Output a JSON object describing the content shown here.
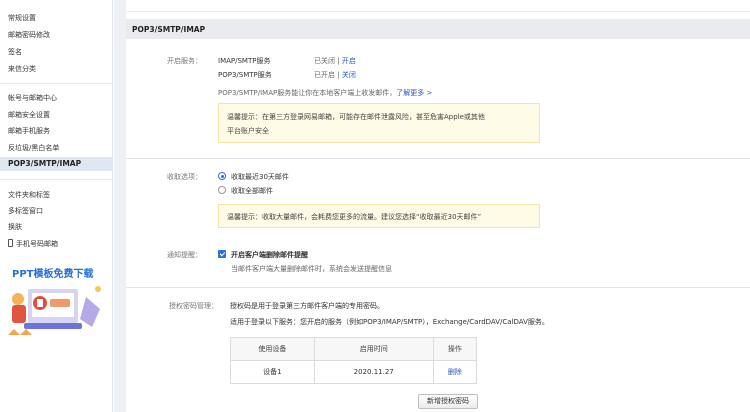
{
  "sidebar": {
    "group1": [
      "常规设置",
      "邮箱密码修改",
      "签名",
      "来信分类"
    ],
    "group2": [
      "帐号与邮箱中心",
      "邮箱安全设置",
      "邮箱手机服务",
      "反垃圾/黑白名单",
      "POP3/SMTP/IMAP"
    ],
    "group3": [
      "文件夹和标签",
      "多标签窗口",
      "换肤",
      "手机号码邮箱"
    ],
    "ad_title": "PPT模板免费下载"
  },
  "section": {
    "title": "POP3/SMTP/IMAP"
  },
  "services": {
    "label": "开启服务：",
    "rows": [
      {
        "name": "IMAP/SMTP服务",
        "status": "已关闭",
        "sep": "|",
        "action": "开启"
      },
      {
        "name": "POP3/SMTP服务",
        "status": "已开启",
        "sep": "|",
        "action": "关闭"
      }
    ],
    "desc": "POP3/SMTP/IMAP服务能让你在本地客户端上收发邮件，",
    "learn_more": "了解更多 >",
    "tip_line1": "温馨提示：在第三方登录网易邮箱，可能存在邮件泄露风险，甚至危害Apple或其他",
    "tip_line2": "平台账户安全"
  },
  "receive": {
    "label": "收取选项：",
    "options": [
      "收取最近30天邮件",
      "收取全部邮件"
    ],
    "selected_index": 0,
    "tip": "温馨提示：收取大量邮件，会耗费您更多的流量。建议您选择“收取最近30天邮件”"
  },
  "notify": {
    "label": "通知提醒：",
    "checkbox_label": "开启客户端删除邮件提醒",
    "checked": true,
    "desc": "当邮件客户端大量删除邮件时，系统会发送提醒信息"
  },
  "auth": {
    "label": "授权密码管理：",
    "desc1": "授权码是用于登录第三方邮件客户端的专用密码。",
    "desc2": "适用于登录以下服务：您开启的服务（例如POP3/IMAP/SMTP），Exchange/CardDAV/CalDAV服务。",
    "table": {
      "headers": [
        "使用设备",
        "启用时间",
        "操作"
      ],
      "rows": [
        {
          "device": "设备1",
          "time": "2020.11.27",
          "action": "删除"
        }
      ]
    },
    "add_button": "新增授权密码"
  },
  "colors": {
    "accent": "#2f6fdc",
    "link": "#2a56c6",
    "tip_bg": "#fdfbe5",
    "ad_title": "#2a6fd6"
  }
}
